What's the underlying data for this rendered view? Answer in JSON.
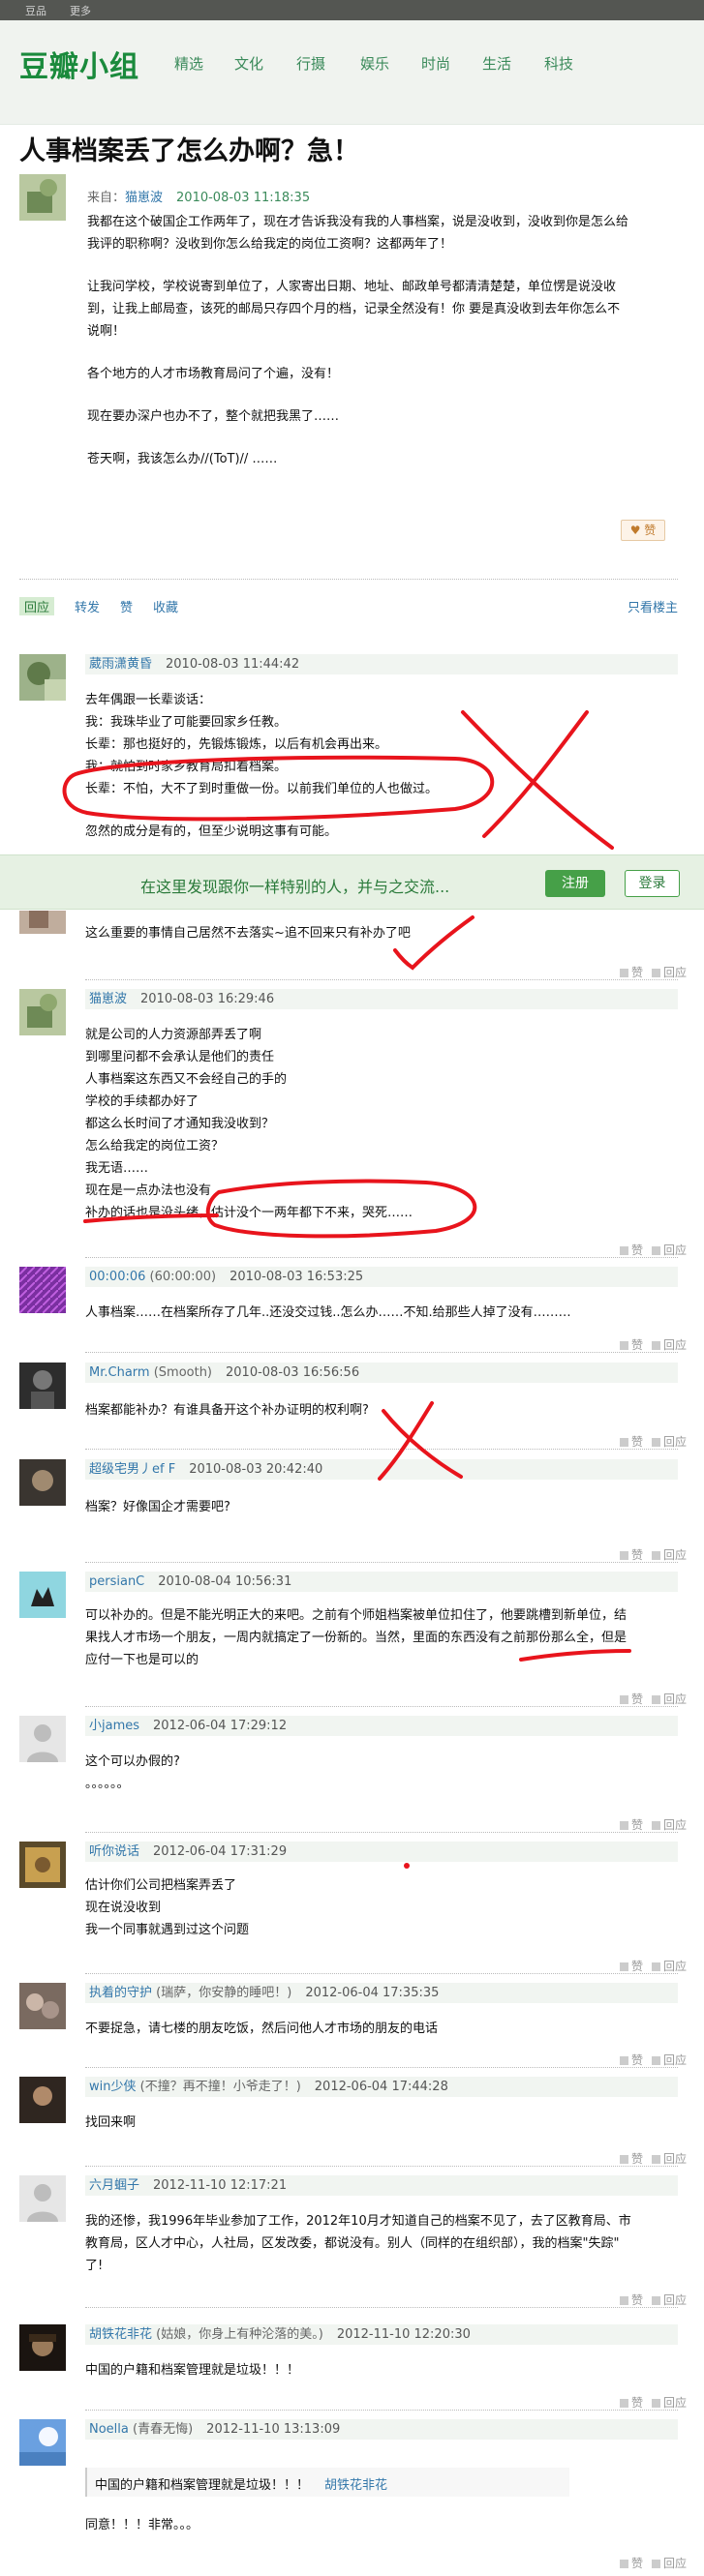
{
  "topbar": {
    "left": "豆品",
    "right": "更多"
  },
  "brand": "豆瓣小组",
  "nav": [
    "精选",
    "文化",
    "行摄",
    "娱乐",
    "时尚",
    "生活",
    "科技"
  ],
  "topic": {
    "title": "人事档案丢了怎么办啊？急！",
    "from_label": "来自：",
    "author": "猫崽波",
    "time": "2010-08-03 11:18:35",
    "body": [
      "我都在这个破国企工作两年了，现在才告诉我没有我的人事档案，说是没收到，没收到你是怎么给",
      "我评的职称啊？没收到你怎么给我定的岗位工资啊？这都两年了！",
      "",
      "让我问学校，学校说寄到单位了，人家寄出日期、地址、邮政单号都清清楚楚，单位愣是说没收",
      "到，让我上邮局查，该死的邮局只存四个月的档，记录全然没有！你 要是真没收到去年你怎么不",
      "说啊！",
      "",
      "各个地方的人才市场教育局问了个遍，没有！",
      "",
      "现在要办深户也办不了，整个就把我黑了……",
      "",
      "苍天啊，我该怎么办//(ToT)// ……"
    ],
    "like_label": "赞"
  },
  "actions": {
    "reply": "回应",
    "share": "转发",
    "like": "赞",
    "collect": "收藏",
    "only_op": "只看楼主"
  },
  "signup": {
    "text": "在这里发现跟你一样特别的人，并与之交流...",
    "register": "注册",
    "login": "登录"
  },
  "op_labels": {
    "like": "赞",
    "reply": "回应"
  },
  "comments": [
    {
      "name": "葳雨潇黄昏",
      "note": "",
      "time": "2010-08-03 11:44:42",
      "lines": [
        "去年偶跟一长辈谈话：",
        "我：我珠毕业了可能要回家乡任教。",
        "长辈：那也挺好的，先锻炼锻炼，以后有机会再出来。",
        "我：就怕到时家乡教育局扣着档案。",
        "长辈：不怕，大不了到时重做一份。以前我们单位的人也做过。",
        "",
        "忽然的成分是有的，但至少说明这事有可能。"
      ]
    },
    {
      "name": "",
      "note": "",
      "time": "",
      "lines": [
        "这么重要的事情自己居然不去落实~追不回来只有补办了吧"
      ]
    },
    {
      "name": "猫崽波",
      "note": "",
      "time": "2010-08-03 16:29:46",
      "lines": [
        "就是公司的人力资源部弄丢了啊",
        "到哪里问都不会承认是他们的责任",
        "人事档案这东西又不会经自己的手的",
        "学校的手续都办好了",
        "都这么长时间了才通知我没收到？",
        "怎么给我定的岗位工资？",
        "我无语……",
        "现在是一点办法也没有",
        "补办的话也是没头绪，估计没个一两年都下不来，哭死……"
      ]
    },
    {
      "name": "00:00:06",
      "note": "(60:00:00)",
      "time": "2010-08-03 16:53:25",
      "lines": [
        "人事档案……在档案所存了几年..还没交过钱..怎么办……不知.给那些人掉了没有………"
      ]
    },
    {
      "name": "Mr.Charm",
      "note": "(Smooth)",
      "time": "2010-08-03 16:56:56",
      "lines": [
        "档案都能补办？有谁具备开这个补办证明的权利啊?"
      ]
    },
    {
      "name": "超级宅男丿ef F",
      "note": "",
      "time": "2010-08-03 20:42:40",
      "lines": [
        "档案？好像国企才需要吧?"
      ]
    },
    {
      "name": "persianC",
      "note": "",
      "time": "2010-08-04 10:56:31",
      "lines": [
        "可以补办的。但是不能光明正大的来吧。之前有个师姐档案被单位扣住了，他要跳槽到新单位，结",
        "果找人才市场一个朋友，一周内就搞定了一份新的。当然，里面的东西没有之前那份那么全，但是",
        "应付一下也是可以的"
      ]
    },
    {
      "name": "小james",
      "note": "",
      "time": "2012-06-04 17:29:12",
      "lines": [
        "这个可以办假的?",
        "。。。。。。"
      ]
    },
    {
      "name": "听你说话",
      "note": "",
      "time": "2012-06-04 17:31:29",
      "lines": [
        "估计你们公司把档案弄丢了",
        "现在说没收到",
        "我一个同事就遇到过这个问题"
      ]
    },
    {
      "name": "执着的守护",
      "note": "(瑞萨，你安静的睡吧！)",
      "time": "2012-06-04 17:35:35",
      "lines": [
        "不要捉急，请七楼的朋友吃饭，然后问他人才市场的朋友的电话"
      ]
    },
    {
      "name": "win少侠",
      "note": "(不撞？再不撞！小爷走了！)",
      "time": "2012-06-04 17:44:28",
      "lines": [
        "找回来啊"
      ]
    },
    {
      "name": "六月蝈子",
      "note": "",
      "time": "2012-11-10 12:17:21",
      "lines": [
        "我的还惨，我1996年毕业参加了工作，2012年10月才知道自己的档案不见了，去了区教育局、市",
        "教育局，区人才中心，人社局，区发改委，都说没有。别人（同样的在组织部），我的档案\"失踪\"",
        "了!"
      ]
    },
    {
      "name": "胡铁花非花",
      "note": "(姑娘，你身上有种沦落的美。)",
      "time": "2012-11-10 12:20:30",
      "lines": [
        "中国的户籍和档案管理就是垃圾！！！"
      ]
    },
    {
      "name": "Noella",
      "note": "(青春无悔)",
      "time": "2012-11-10 13:13:09",
      "lines": [
        "同意！！！非常。。。"
      ]
    }
  ],
  "quote": {
    "text": "中国的户籍和档案管理就是垃圾！！！",
    "author": "胡铁花非花"
  },
  "annotation_label": "X"
}
